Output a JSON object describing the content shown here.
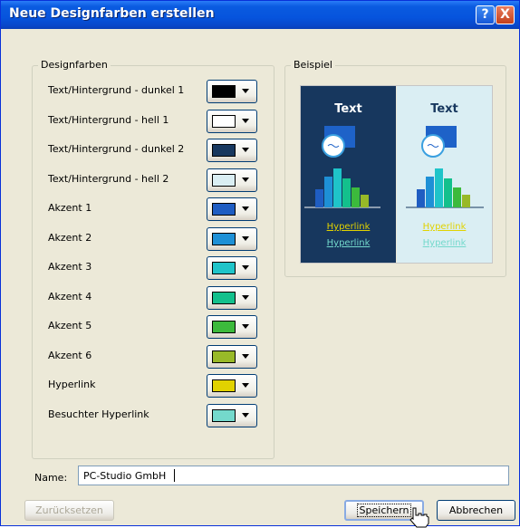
{
  "dialog": {
    "title": "Neue Designfarben erstellen",
    "help_glyph": "?",
    "close_glyph": "X"
  },
  "theme_group": {
    "legend": "Designfarben",
    "rows": [
      {
        "label": "Text/Hintergrund - dunkel 1",
        "color": "#000000"
      },
      {
        "label": "Text/Hintergrund - hell 1",
        "color": "#ffffff"
      },
      {
        "label": "Text/Hintergrund - dunkel 2",
        "color": "#17375e"
      },
      {
        "label": "Text/Hintergrund - hell 2",
        "color": "#daeef3"
      },
      {
        "label": "Akzent 1",
        "color": "#1f5dc2"
      },
      {
        "label": "Akzent 2",
        "color": "#1e90d6"
      },
      {
        "label": "Akzent 3",
        "color": "#1fc4c9"
      },
      {
        "label": "Akzent 4",
        "color": "#13c08c"
      },
      {
        "label": "Akzent 5",
        "color": "#3cba3c"
      },
      {
        "label": "Akzent 6",
        "color": "#98b928"
      },
      {
        "label": "Hyperlink",
        "color": "#e1d200"
      },
      {
        "label": "Besuchter Hyperlink",
        "color": "#74d9cc"
      }
    ]
  },
  "sample_group": {
    "legend": "Beispiel",
    "dark": {
      "background": "#17375e",
      "text": "Text",
      "text_color": "#ffffff",
      "hyperlink": "Hyperlink",
      "visited": "Hyperlink"
    },
    "light": {
      "background": "#daeef3",
      "text": "Text",
      "text_color": "#17375e",
      "hyperlink": "Hyperlink",
      "visited": "Hyperlink"
    },
    "hyperlink_color": "#e1d200",
    "visited_color": "#74d9cc"
  },
  "name_field": {
    "label": "Name:",
    "value": "PC-Studio GmbH"
  },
  "buttons": {
    "reset": "Zurücksetzen",
    "save": "Speichern",
    "cancel": "Abbrechen"
  }
}
